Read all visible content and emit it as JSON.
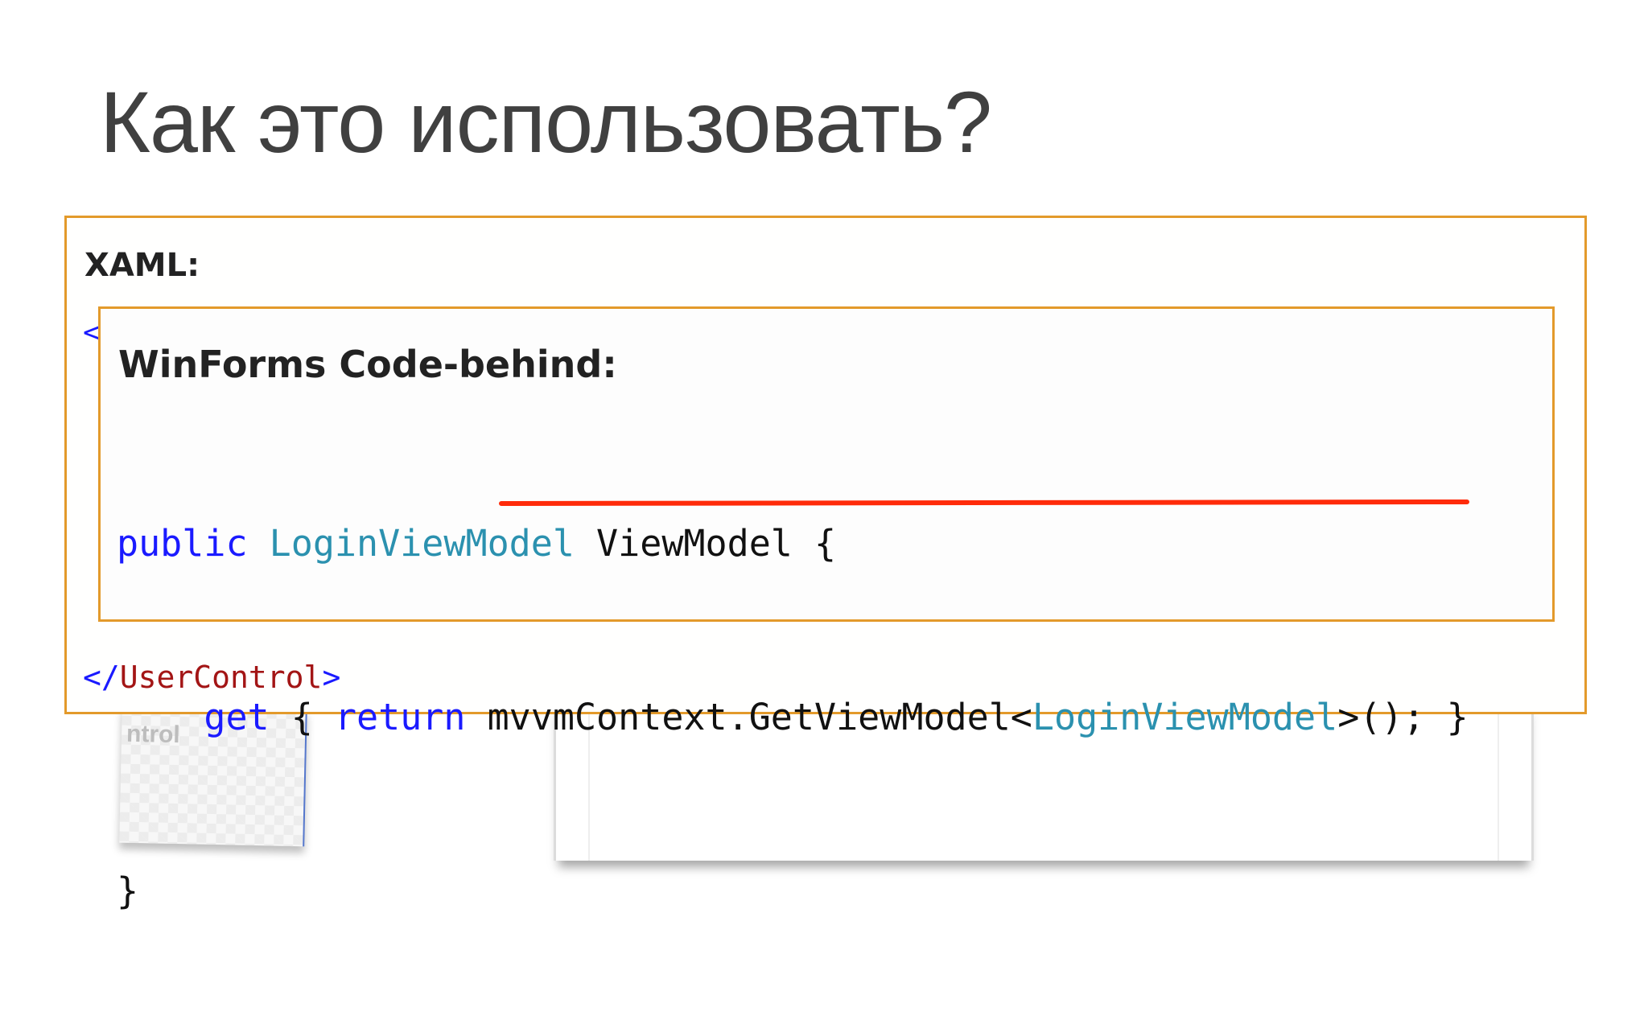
{
  "slide": {
    "title": "Как это использовать?"
  },
  "xaml_panel": {
    "heading": "XAML:",
    "open_tag_fragment": "<",
    "closing_tag": {
      "open_bracket": "</",
      "name": "UserControl",
      "close_bracket": ">"
    }
  },
  "winforms_panel": {
    "heading": "WinForms Code-behind:",
    "code": {
      "line1": {
        "keyword": "public",
        "type": "LoginViewModel",
        "rest": "ViewModel {"
      },
      "line2": {
        "indent": "    ",
        "keyword_get": "get",
        "brace_open": " { ",
        "keyword_return": "return",
        "call_prefix": " mvvmContext.GetViewModel<",
        "generic_type": "LoginViewModel",
        "call_suffix": ">(); }"
      },
      "line3": "}"
    },
    "highlight_color": "#ff2b0a"
  },
  "background": {
    "user_control_fragment": "ntrol"
  },
  "colors": {
    "panel_border": "#e39a2b",
    "keyword": "#1a1aff",
    "type": "#2b91af",
    "tag_name": "#a31515",
    "title": "#404040"
  }
}
